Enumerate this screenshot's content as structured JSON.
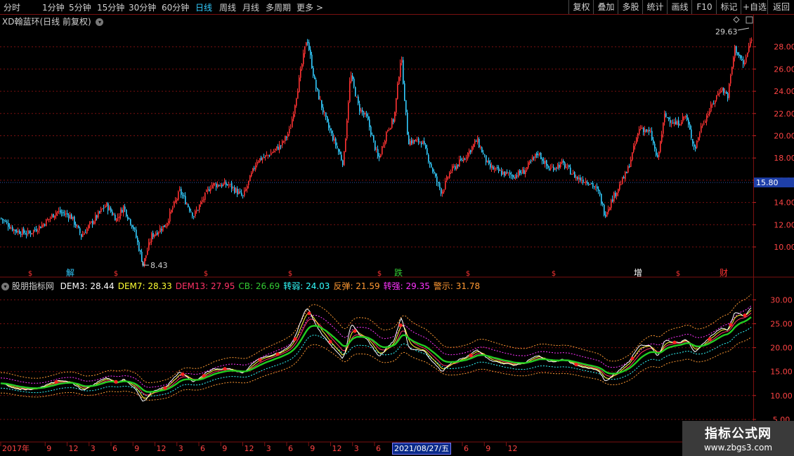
{
  "toolbar": {
    "periods": [
      "分时",
      "1分钟",
      "5分钟",
      "15分钟",
      "30分钟",
      "60分钟",
      "日线",
      "周线",
      "月线",
      "多周期",
      "更多 >"
    ],
    "active_period": "日线",
    "right_buttons": [
      "复权",
      "叠加",
      "多股",
      "统计",
      "画线",
      "F10",
      "标记",
      "+自选",
      "返回"
    ]
  },
  "main_panel": {
    "title": "XD翰蓝环(日线 前复权)",
    "high_label": "29.63",
    "low_label": "8.43",
    "current_price": "15.80",
    "price_axis": [
      "28.00",
      "26.00",
      "24.00",
      "22.00",
      "20.00",
      "18.00",
      "16.00",
      "14.00",
      "12.00",
      "10.00"
    ],
    "signals": [
      "$",
      "解",
      "$",
      "$",
      "$",
      "$",
      "跌",
      "$",
      "$",
      "增",
      "$",
      "财"
    ]
  },
  "indicator_panel": {
    "name": "股朋指标网",
    "values": [
      {
        "label": "DEM3: 28.44",
        "color": "#ffffff"
      },
      {
        "label": "DEM7: 28.33",
        "color": "#ffff33"
      },
      {
        "label": "DEM13: 27.95",
        "color": "#ff3366"
      },
      {
        "label": "CB: 26.69",
        "color": "#33cc33"
      },
      {
        "label": "转弱: 24.03",
        "color": "#33ffff"
      },
      {
        "label": "反弹: 21.59",
        "color": "#ff9933"
      },
      {
        "label": "转强: 29.35",
        "color": "#ff33ff"
      },
      {
        "label": "警示: 31.78",
        "color": "#ff9933"
      }
    ],
    "axis": [
      "30.00",
      "25.00",
      "20.00",
      "15.00",
      "10.00",
      "5.00"
    ]
  },
  "time_axis": {
    "labels": [
      "2017年",
      "9",
      "12",
      "3",
      "6",
      "9",
      "12",
      "3",
      "6",
      "9",
      "12",
      "3",
      "6",
      "9",
      "12",
      "3",
      "6",
      "9",
      "12",
      "3",
      "6",
      "9",
      "12"
    ],
    "cursor_date": "2021/08/27/五"
  },
  "watermark": {
    "line1": "指标公式网",
    "line2": "www.zbgs3.com"
  },
  "colors": {
    "up": "#ff3333",
    "down": "#33ccff",
    "grid": "#7a1010",
    "cb": "#22cc22"
  }
}
